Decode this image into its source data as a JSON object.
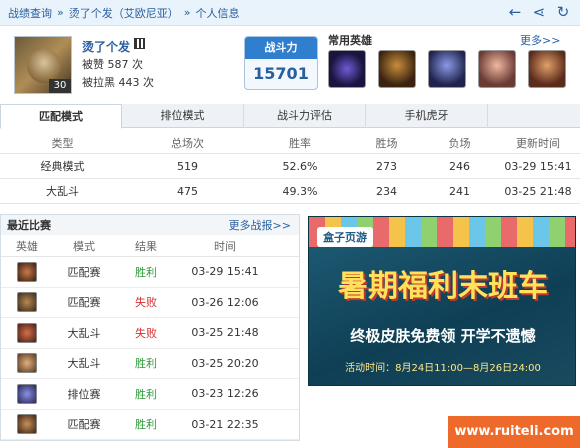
{
  "breadcrumb": [
    "战绩查询",
    "烫了个发（艾欧尼亚）",
    "个人信息"
  ],
  "profile": {
    "name": "烫了个发",
    "level": "30",
    "praise": "被赞 587 次",
    "blacklist": "被拉黑 443 次"
  },
  "power": {
    "label": "战斗力",
    "value": "15701"
  },
  "heroes": {
    "title": "常用英雄",
    "more": "更多>>"
  },
  "tabs": [
    "匹配模式",
    "排位模式",
    "战斗力评估",
    "手机虎牙"
  ],
  "stats": {
    "headers": [
      "类型",
      "总场次",
      "胜率",
      "胜场",
      "负场",
      "更新时间"
    ],
    "rows": [
      [
        "经典模式",
        "519",
        "52.6%",
        "273",
        "246",
        "03-29 15:41"
      ],
      [
        "大乱斗",
        "475",
        "49.3%",
        "234",
        "241",
        "03-25 21:48"
      ]
    ]
  },
  "recent": {
    "title": "最近比赛",
    "more": "更多战报>>",
    "headers": [
      "英雄",
      "模式",
      "结果",
      "时间"
    ],
    "rows": [
      {
        "mode": "匹配赛",
        "result": "胜利",
        "time": "03-29 15:41"
      },
      {
        "mode": "匹配赛",
        "result": "失败",
        "time": "03-26 12:06"
      },
      {
        "mode": "大乱斗",
        "result": "失败",
        "time": "03-25 21:48"
      },
      {
        "mode": "大乱斗",
        "result": "胜利",
        "time": "03-25 20:20"
      },
      {
        "mode": "排位赛",
        "result": "胜利",
        "time": "03-23 12:26"
      },
      {
        "mode": "匹配赛",
        "result": "胜利",
        "time": "03-21 22:35"
      }
    ]
  },
  "banner": {
    "logo": "盒子页游",
    "title": "暑期福利末班车",
    "line1": "终极皮肤免费领 开学不遗憾",
    "line2": "活动时间：8月24日11:00—8月26日24:00"
  },
  "watermark": "www.ruiteli.com"
}
